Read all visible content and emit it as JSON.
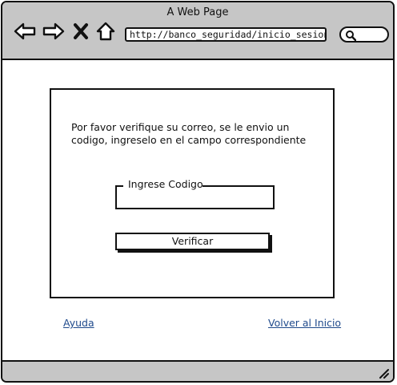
{
  "window": {
    "title": "A Web Page"
  },
  "toolbar": {
    "back_icon": "arrow-left-icon",
    "forward_icon": "arrow-right-icon",
    "stop_icon": "close-icon",
    "home_icon": "home-icon",
    "address": "http://banco_seguridad/inicio_sesion/",
    "search_icon": "search-icon"
  },
  "verification": {
    "message": "Por favor verifique su correo, se le envio un codigo, ingreselo en el campo correspondiente",
    "code_label": "Ingrese Codigo",
    "code_value": "",
    "verify_label": "Verificar"
  },
  "links": {
    "help": "Ayuda",
    "home": "Volver al Inicio"
  },
  "colors": {
    "chrome": "#c6c6c6",
    "link": "#1f4a8c"
  }
}
